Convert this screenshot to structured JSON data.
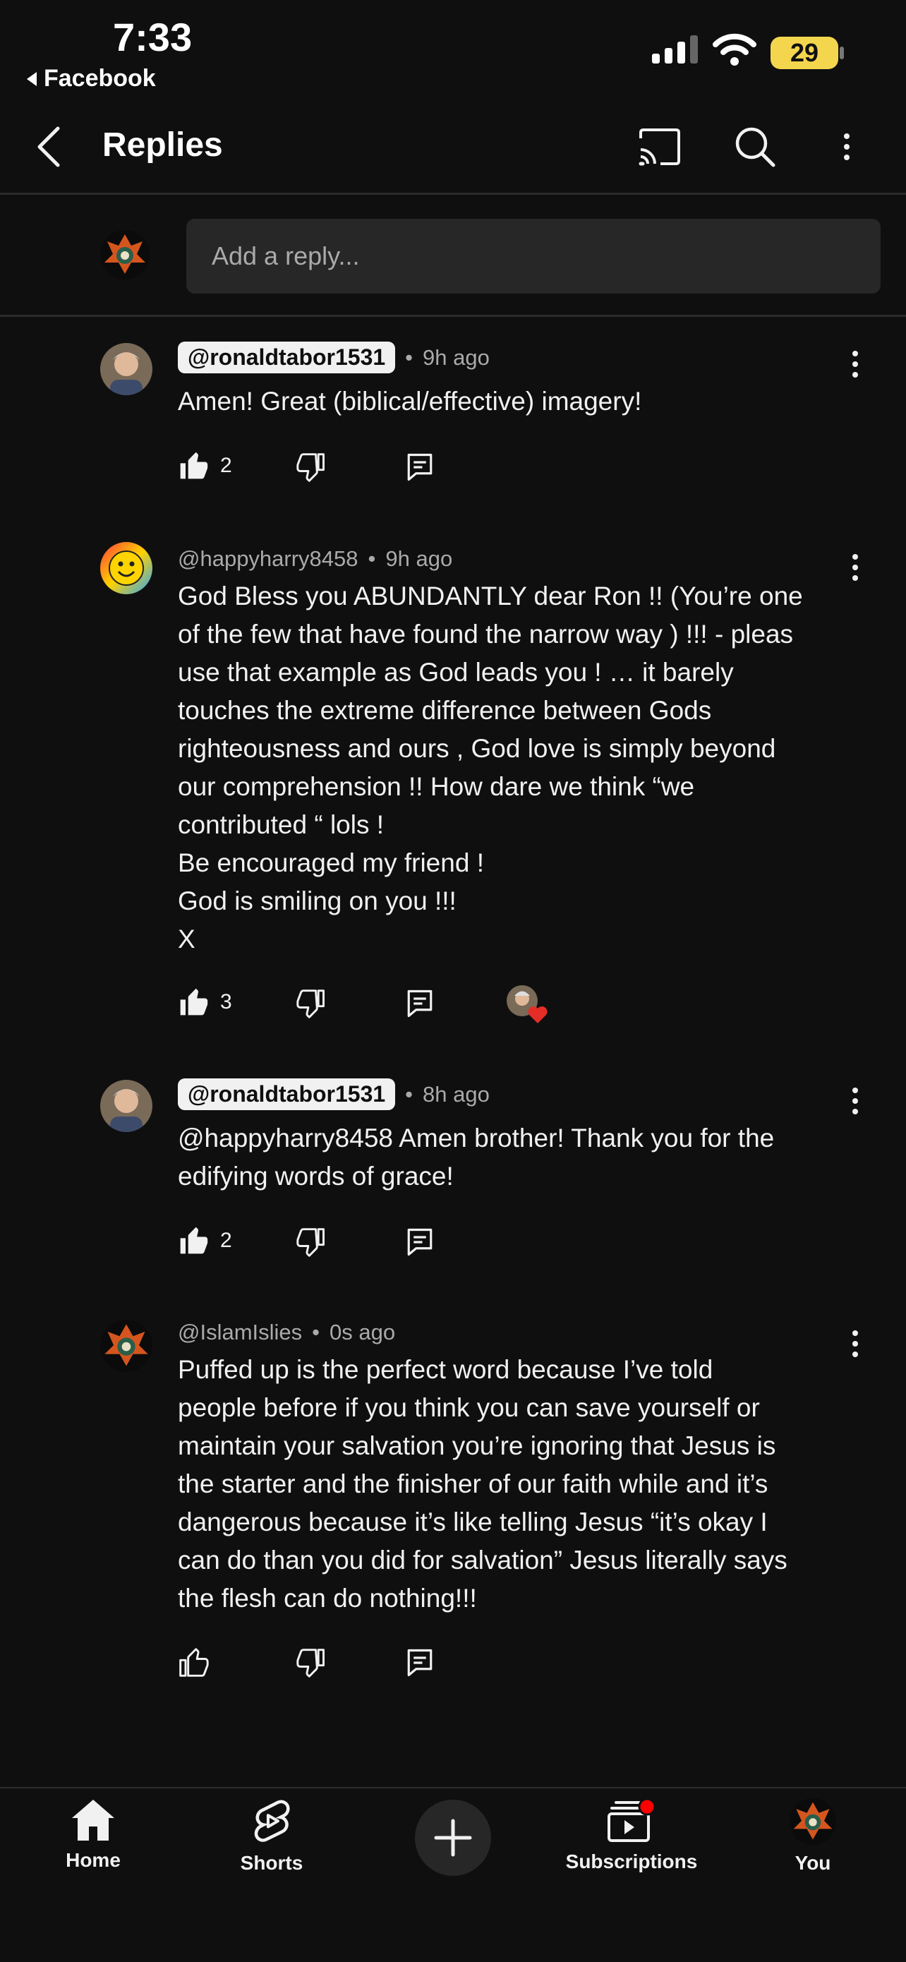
{
  "status": {
    "time": "7:33",
    "back_app": "Facebook",
    "battery": "29"
  },
  "header": {
    "title": "Replies"
  },
  "reply_input": {
    "placeholder": "Add a reply..."
  },
  "comments": [
    {
      "handle": "@ronaldtabor1531",
      "highlighted": true,
      "time": "9h ago",
      "text": "Amen! Great (biblical/effective) imagery!",
      "likes": "2",
      "liked": true
    },
    {
      "handle": "@happyharry8458",
      "highlighted": false,
      "time": "9h ago",
      "text": "God Bless you ABUNDANTLY dear Ron !! (You’re one\nof the few that have found the narrow way ) !!! - pleas\nuse that example as God leads you ! … it barely\ntouches the extreme difference between Gods\nrighteousness and ours , God love is simply beyond\nour comprehension !! How dare we think “we\ncontributed “ lols !\nBe encouraged my friend !\nGod is smiling on you !!!\nX",
      "likes": "3",
      "liked": true,
      "creator_hearted": true
    },
    {
      "handle": "@ronaldtabor1531",
      "highlighted": true,
      "time": "8h ago",
      "text": "@happyharry8458 Amen brother! Thank you for the\nedifying words of grace!",
      "likes": "2",
      "liked": true
    },
    {
      "handle": "@IslamIslies",
      "highlighted": false,
      "time": "0s ago",
      "text": "Puffed up is the perfect word because I’ve told\npeople before if you think you can save yourself or\nmaintain your salvation you’re ignoring that Jesus is\nthe starter and the finisher of our faith while and it’s\ndangerous because it’s like telling Jesus “it’s okay I\ncan do than you did for salvation” Jesus literally says\nthe flesh can do nothing!!!",
      "likes": "",
      "liked": false
    }
  ],
  "bottom_nav": {
    "home": "Home",
    "shorts": "Shorts",
    "subscriptions": "Subscriptions",
    "you": "You"
  },
  "colors": {
    "background": "#0f0f0f",
    "battery": "#f4d64e",
    "notification": "#ff0000",
    "heart": "#e52d27"
  }
}
